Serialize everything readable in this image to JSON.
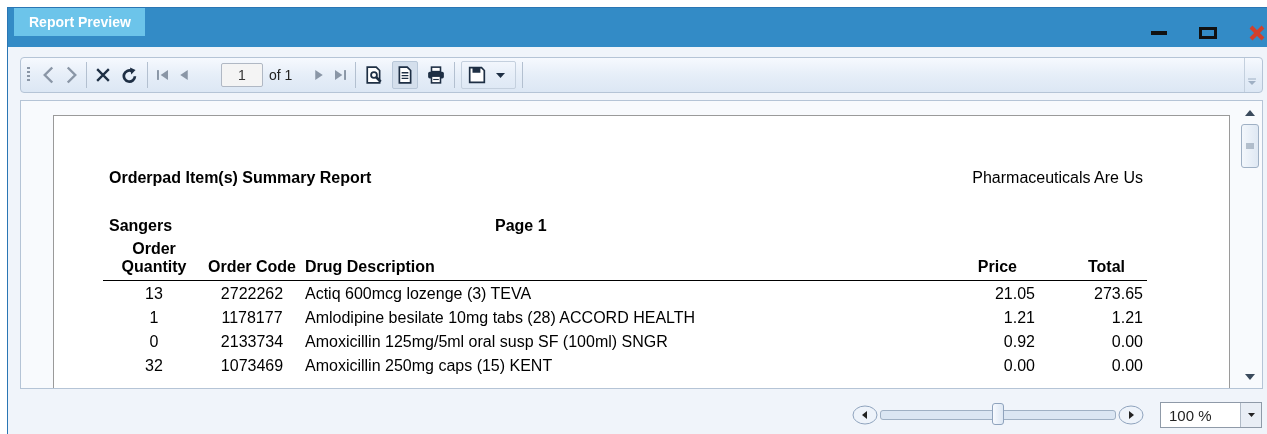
{
  "window": {
    "title": "Report Preview"
  },
  "toolbar": {
    "groups": [
      [
        {
          "kind": "back",
          "disabled": true,
          "pressed": false
        },
        {
          "kind": "forward",
          "disabled": true,
          "pressed": false
        }
      ],
      [
        {
          "kind": "stop",
          "disabled": false,
          "pressed": false
        },
        {
          "kind": "refresh",
          "disabled": false,
          "pressed": false
        }
      ],
      [
        {
          "kind": "first",
          "disabled": true,
          "pressed": false
        },
        {
          "kind": "previous",
          "disabled": true,
          "pressed": false
        },
        {
          "kind": "page"
        },
        {
          "kind": "next",
          "disabled": true,
          "pressed": false
        },
        {
          "kind": "last",
          "disabled": true,
          "pressed": false
        }
      ],
      [
        {
          "kind": "page-setup",
          "disabled": false,
          "pressed": false
        },
        {
          "kind": "print-layout",
          "disabled": false,
          "pressed": true
        },
        {
          "kind": "print",
          "disabled": false,
          "pressed": false
        }
      ],
      [
        {
          "kind": "export",
          "disabled": false,
          "pressed": false
        }
      ]
    ],
    "page_number": "1",
    "page_count": "of 1"
  },
  "report": {
    "title": "Orderpad Item(s) Summary Report",
    "company": "Pharmaceuticals Are Us",
    "customer": "Sangers",
    "page_label": "Page 1",
    "columns": [
      "Order Quantity",
      "Order Code",
      "Drug Description",
      "Price",
      "Total"
    ],
    "rows": [
      [
        "13",
        "2722262",
        "Actiq 600mcg lozenge (3) TEVA",
        "21.05",
        "273.65"
      ],
      [
        "1",
        "1178177",
        "Amlodipine besilate 10mg tabs (28) ACCORD HEALTH",
        "1.21",
        "1.21"
      ],
      [
        "0",
        "2133734",
        "Amoxicillin 125mg/5ml oral susp SF (100ml) SNGR",
        "0.92",
        "0.00"
      ],
      [
        "32",
        "1073469",
        "Amoxicillin 250mg caps (15) KENT",
        "0.00",
        "0.00"
      ]
    ]
  },
  "zoom": {
    "level": 0.5,
    "value": "100 %"
  }
}
